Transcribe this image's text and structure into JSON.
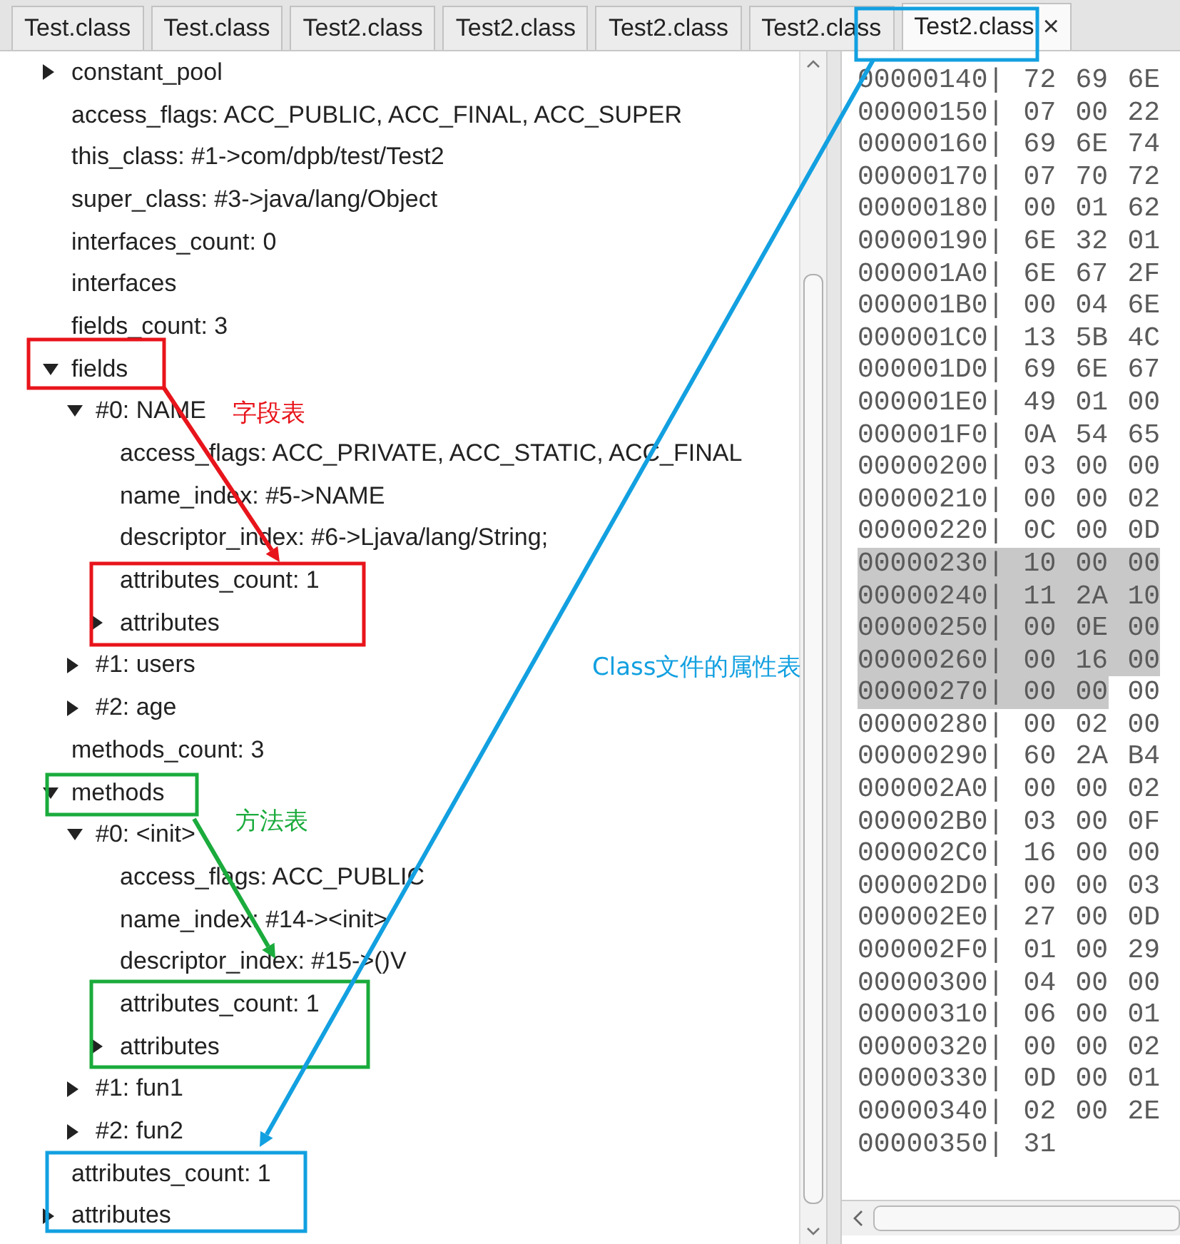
{
  "tabs": [
    {
      "label": "Test.class",
      "selected": false
    },
    {
      "label": "Test.class",
      "selected": false
    },
    {
      "label": "Test2.class",
      "selected": false
    },
    {
      "label": "Test2.class",
      "selected": false
    },
    {
      "label": "Test2.class",
      "selected": false
    },
    {
      "label": "Test2.class",
      "selected": false
    },
    {
      "label": "Test2.class",
      "selected": true,
      "close": "×"
    }
  ],
  "tree": [
    {
      "label": "constant_pool",
      "kind": "branch",
      "expanded": false
    },
    {
      "label": "access_flags: ACC_PUBLIC, ACC_FINAL, ACC_SUPER",
      "kind": "leaf"
    },
    {
      "label": "this_class: #1->com/dpb/test/Test2",
      "kind": "leaf"
    },
    {
      "label": "super_class: #3->java/lang/Object",
      "kind": "leaf"
    },
    {
      "label": "interfaces_count: 0",
      "kind": "leaf"
    },
    {
      "label": "interfaces",
      "kind": "leaf"
    },
    {
      "label": "fields_count: 3",
      "kind": "leaf"
    },
    {
      "label": "fields",
      "kind": "branch",
      "expanded": true,
      "children": [
        {
          "label": "#0: NAME",
          "kind": "branch",
          "expanded": true,
          "children": [
            {
              "label": "access_flags: ACC_PRIVATE, ACC_STATIC, ACC_FINAL",
              "kind": "leaf"
            },
            {
              "label": "name_index: #5->NAME",
              "kind": "leaf"
            },
            {
              "label": "descriptor_index: #6->Ljava/lang/String;",
              "kind": "leaf"
            },
            {
              "label": "attributes_count: 1",
              "kind": "leaf"
            },
            {
              "label": "attributes",
              "kind": "branch",
              "expanded": false
            }
          ]
        },
        {
          "label": "#1: users",
          "kind": "branch",
          "expanded": false
        },
        {
          "label": "#2: age",
          "kind": "branch",
          "expanded": false
        }
      ]
    },
    {
      "label": "methods_count: 3",
      "kind": "leaf"
    },
    {
      "label": "methods",
      "kind": "branch",
      "expanded": true,
      "children": [
        {
          "label": "#0: <init>",
          "kind": "branch",
          "expanded": true,
          "children": [
            {
              "label": "access_flags: ACC_PUBLIC",
              "kind": "leaf"
            },
            {
              "label": "name_index: #14-><init>",
              "kind": "leaf"
            },
            {
              "label": "descriptor_index: #15->()V",
              "kind": "leaf"
            },
            {
              "label": "attributes_count: 1",
              "kind": "leaf"
            },
            {
              "label": "attributes",
              "kind": "branch",
              "expanded": false
            }
          ]
        },
        {
          "label": "#1: fun1",
          "kind": "branch",
          "expanded": false
        },
        {
          "label": "#2: fun2",
          "kind": "branch",
          "expanded": false
        }
      ]
    },
    {
      "label": "attributes_count: 1",
      "kind": "leaf"
    },
    {
      "label": "attributes",
      "kind": "branch",
      "expanded": false
    }
  ],
  "hex_rows": [
    {
      "offset": "00000140|",
      "bytes": [
        {
          "text": "72",
          "selected": false
        },
        {
          "text": "69",
          "selected": false
        },
        {
          "text": "6E",
          "selected": false
        }
      ]
    },
    {
      "offset": "00000150|",
      "bytes": [
        {
          "text": "07",
          "selected": false
        },
        {
          "text": "00",
          "selected": false
        },
        {
          "text": "22",
          "selected": false
        }
      ]
    },
    {
      "offset": "00000160|",
      "bytes": [
        {
          "text": "69",
          "selected": false
        },
        {
          "text": "6E",
          "selected": false
        },
        {
          "text": "74",
          "selected": false
        }
      ]
    },
    {
      "offset": "00000170|",
      "bytes": [
        {
          "text": "07",
          "selected": false
        },
        {
          "text": "70",
          "selected": false
        },
        {
          "text": "72",
          "selected": false
        }
      ]
    },
    {
      "offset": "00000180|",
      "bytes": [
        {
          "text": "00",
          "selected": false
        },
        {
          "text": "01",
          "selected": false
        },
        {
          "text": "62",
          "selected": false
        }
      ]
    },
    {
      "offset": "00000190|",
      "bytes": [
        {
          "text": "6E",
          "selected": false
        },
        {
          "text": "32",
          "selected": false
        },
        {
          "text": "01",
          "selected": false
        }
      ]
    },
    {
      "offset": "000001A0|",
      "bytes": [
        {
          "text": "6E",
          "selected": false
        },
        {
          "text": "67",
          "selected": false
        },
        {
          "text": "2F",
          "selected": false
        }
      ]
    },
    {
      "offset": "000001B0|",
      "bytes": [
        {
          "text": "00",
          "selected": false
        },
        {
          "text": "04",
          "selected": false
        },
        {
          "text": "6E",
          "selected": false
        }
      ]
    },
    {
      "offset": "000001C0|",
      "bytes": [
        {
          "text": "13",
          "selected": false
        },
        {
          "text": "5B",
          "selected": false
        },
        {
          "text": "4C",
          "selected": false
        }
      ]
    },
    {
      "offset": "000001D0|",
      "bytes": [
        {
          "text": "69",
          "selected": false
        },
        {
          "text": "6E",
          "selected": false
        },
        {
          "text": "67",
          "selected": false
        }
      ]
    },
    {
      "offset": "000001E0|",
      "bytes": [
        {
          "text": "49",
          "selected": false
        },
        {
          "text": "01",
          "selected": false
        },
        {
          "text": "00",
          "selected": false
        }
      ]
    },
    {
      "offset": "000001F0|",
      "bytes": [
        {
          "text": "0A",
          "selected": false
        },
        {
          "text": "54",
          "selected": false
        },
        {
          "text": "65",
          "selected": false
        }
      ]
    },
    {
      "offset": "00000200|",
      "bytes": [
        {
          "text": "03",
          "selected": false
        },
        {
          "text": "00",
          "selected": false
        },
        {
          "text": "00",
          "selected": false
        }
      ]
    },
    {
      "offset": "00000210|",
      "bytes": [
        {
          "text": "00",
          "selected": false
        },
        {
          "text": "00",
          "selected": false
        },
        {
          "text": "02",
          "selected": false
        }
      ]
    },
    {
      "offset": "00000220|",
      "bytes": [
        {
          "text": "0C",
          "selected": false
        },
        {
          "text": "00",
          "selected": false
        },
        {
          "text": "0D",
          "selected": false
        }
      ]
    },
    {
      "offset": "00000230|",
      "bytes": [
        {
          "text": "10",
          "selected": true
        },
        {
          "text": "00",
          "selected": true
        },
        {
          "text": "00",
          "selected": true
        }
      ]
    },
    {
      "offset": "00000240|",
      "bytes": [
        {
          "text": "11",
          "selected": true
        },
        {
          "text": "2A",
          "selected": true
        },
        {
          "text": "10",
          "selected": true
        }
      ]
    },
    {
      "offset": "00000250|",
      "bytes": [
        {
          "text": "00",
          "selected": true
        },
        {
          "text": "0E",
          "selected": true
        },
        {
          "text": "00",
          "selected": true
        }
      ]
    },
    {
      "offset": "00000260|",
      "bytes": [
        {
          "text": "00",
          "selected": true
        },
        {
          "text": "16",
          "selected": true
        },
        {
          "text": "00",
          "selected": true
        }
      ]
    },
    {
      "offset": "00000270|",
      "bytes": [
        {
          "text": "00",
          "selected": true
        },
        {
          "text": "00",
          "selected": true
        },
        {
          "text": "00",
          "selected": false
        }
      ]
    },
    {
      "offset": "00000280|",
      "bytes": [
        {
          "text": "00",
          "selected": false
        },
        {
          "text": "02",
          "selected": false
        },
        {
          "text": "00",
          "selected": false
        }
      ]
    },
    {
      "offset": "00000290|",
      "bytes": [
        {
          "text": "60",
          "selected": false
        },
        {
          "text": "2A",
          "selected": false
        },
        {
          "text": "B4",
          "selected": false
        }
      ]
    },
    {
      "offset": "000002A0|",
      "bytes": [
        {
          "text": "00",
          "selected": false
        },
        {
          "text": "00",
          "selected": false
        },
        {
          "text": "02",
          "selected": false
        }
      ]
    },
    {
      "offset": "000002B0|",
      "bytes": [
        {
          "text": "03",
          "selected": false
        },
        {
          "text": "00",
          "selected": false
        },
        {
          "text": "0F",
          "selected": false
        }
      ]
    },
    {
      "offset": "000002C0|",
      "bytes": [
        {
          "text": "16",
          "selected": false
        },
        {
          "text": "00",
          "selected": false
        },
        {
          "text": "00",
          "selected": false
        }
      ]
    },
    {
      "offset": "000002D0|",
      "bytes": [
        {
          "text": "00",
          "selected": false
        },
        {
          "text": "00",
          "selected": false
        },
        {
          "text": "03",
          "selected": false
        }
      ]
    },
    {
      "offset": "000002E0|",
      "bytes": [
        {
          "text": "27",
          "selected": false
        },
        {
          "text": "00",
          "selected": false
        },
        {
          "text": "0D",
          "selected": false
        }
      ]
    },
    {
      "offset": "000002F0|",
      "bytes": [
        {
          "text": "01",
          "selected": false
        },
        {
          "text": "00",
          "selected": false
        },
        {
          "text": "29",
          "selected": false
        }
      ]
    },
    {
      "offset": "00000300|",
      "bytes": [
        {
          "text": "04",
          "selected": false
        },
        {
          "text": "00",
          "selected": false
        },
        {
          "text": "00",
          "selected": false
        }
      ]
    },
    {
      "offset": "00000310|",
      "bytes": [
        {
          "text": "06",
          "selected": false
        },
        {
          "text": "00",
          "selected": false
        },
        {
          "text": "01",
          "selected": false
        }
      ]
    },
    {
      "offset": "00000320|",
      "bytes": [
        {
          "text": "00",
          "selected": false
        },
        {
          "text": "00",
          "selected": false
        },
        {
          "text": "02",
          "selected": false
        }
      ]
    },
    {
      "offset": "00000330|",
      "bytes": [
        {
          "text": "0D",
          "selected": false
        },
        {
          "text": "00",
          "selected": false
        },
        {
          "text": "01",
          "selected": false
        }
      ]
    },
    {
      "offset": "00000340|",
      "bytes": [
        {
          "text": "02",
          "selected": false
        },
        {
          "text": "00",
          "selected": false
        },
        {
          "text": "2E",
          "selected": false
        }
      ]
    },
    {
      "offset": "00000350|",
      "bytes": [
        {
          "text": "31",
          "selected": false
        }
      ]
    }
  ],
  "annotations": [
    {
      "label": "字段表",
      "color": "#e8141b"
    },
    {
      "label": "方法表",
      "color": "#1aab3c"
    },
    {
      "label": "Class文件的属性表",
      "color": "#12a0e0"
    }
  ]
}
